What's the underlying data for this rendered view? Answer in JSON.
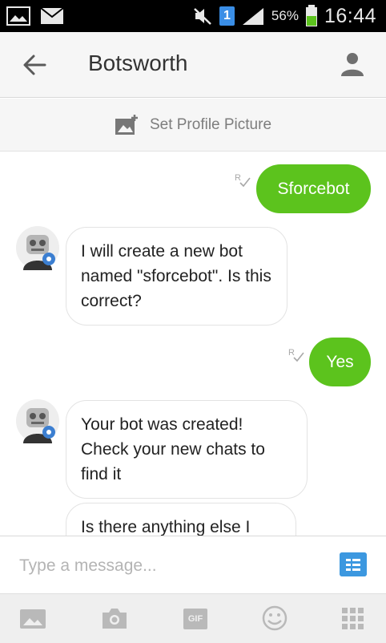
{
  "status_bar": {
    "sim_number": "1",
    "battery_percent": "56%",
    "time": "16:44"
  },
  "header": {
    "title": "Botsworth",
    "back_icon": "arrow-left-icon",
    "profile_icon": "person-icon"
  },
  "profile_strip": {
    "label": "Set Profile Picture",
    "icon": "add-photo-icon"
  },
  "messages": [
    {
      "direction": "outgoing",
      "text": "Sforcebot",
      "status_icon": "read-receipt-icon"
    },
    {
      "direction": "incoming",
      "text": "I will create a new bot named \"sforcebot\". Is this correct?",
      "avatar": "robot-avatar"
    },
    {
      "direction": "outgoing",
      "text": "Yes",
      "status_icon": "read-receipt-icon"
    },
    {
      "direction": "incoming",
      "text": "Your bot was created! Check your new chats to find it",
      "avatar": "robot-avatar"
    },
    {
      "direction": "incoming",
      "text": "Is there anything else I"
    }
  ],
  "input": {
    "placeholder": "Type a message...",
    "value": ""
  },
  "toolbar": {
    "items": [
      "gallery-icon",
      "camera-icon",
      "gif-icon",
      "emoji-icon",
      "apps-grid-icon"
    ],
    "gif_label": "GIF"
  },
  "colors": {
    "outgoing_bubble": "#5cc31d",
    "quick_reply_button": "#3c98e0",
    "header_bg": "#f6f6f6"
  }
}
